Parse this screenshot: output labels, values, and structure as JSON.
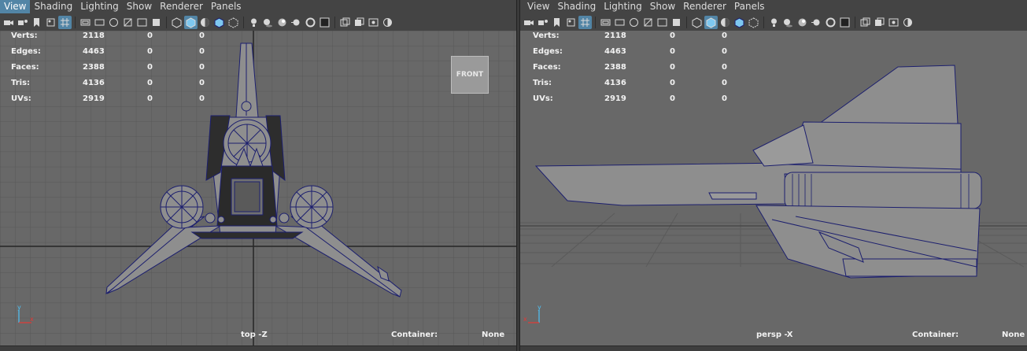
{
  "menu": [
    "View",
    "Shading",
    "Lighting",
    "Show",
    "Renderer",
    "Panels"
  ],
  "hud": {
    "rows": [
      {
        "label": "Verts:",
        "v1": "2118",
        "v2": "0",
        "v3": "0"
      },
      {
        "label": "Edges:",
        "v1": "4463",
        "v2": "0",
        "v3": "0"
      },
      {
        "label": "Faces:",
        "v1": "2388",
        "v2": "0",
        "v3": "0"
      },
      {
        "label": "Tris:",
        "v1": "4136",
        "v2": "0",
        "v3": "0"
      },
      {
        "label": "UVs:",
        "v1": "2919",
        "v2": "0",
        "v3": "0"
      }
    ]
  },
  "left_panel": {
    "camera_label": "top -Z",
    "container_label": "Container:",
    "container_value": "None",
    "viewcube_label": "FRONT"
  },
  "right_panel": {
    "camera_label": "persp -X",
    "container_label": "Container:",
    "container_value": "None"
  },
  "axis": {
    "y": "y",
    "x": "x"
  },
  "colors": {
    "accent": "#5285a6",
    "viewport_bg": "#686868",
    "wire": "#1c1f6e",
    "model_fill": "#8e8e8e"
  },
  "toolbar_icons": [
    "camera-icon",
    "camera-attributes-icon",
    "bookmark-icon",
    "image-plane-icon",
    "grid-toggle-icon",
    "film-gate-icon",
    "resolution-gate-icon",
    "gate-mask-icon",
    "field-chart-icon",
    "safe-action-icon",
    "isolate-icon",
    "wireframe-icon",
    "smooth-shade-icon",
    "default-material-icon",
    "wireframe-on-shaded-icon",
    "xray-icon",
    "lights-icon",
    "shadows-icon",
    "screen-space-ao-icon",
    "motion-blur-icon",
    "anti-alias-icon",
    "depth-of-field-icon",
    "isolate-select-icon",
    "xray-joints-icon",
    "xray-active-icon",
    "gamma-icon"
  ]
}
